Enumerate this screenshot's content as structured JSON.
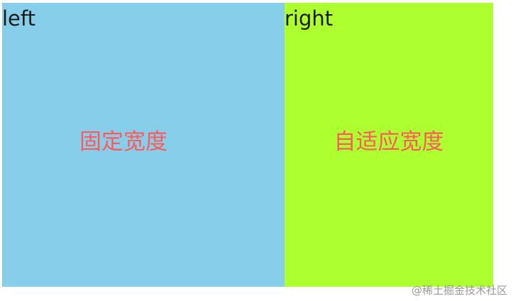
{
  "left": {
    "label": "left",
    "caption": "固定宽度",
    "background": "#87ceeb"
  },
  "right": {
    "label": "right",
    "caption": "自适应宽度",
    "background": "#adff2f"
  },
  "caption_color": "#ff5a5a",
  "watermark": "@稀土掘金技术社区"
}
